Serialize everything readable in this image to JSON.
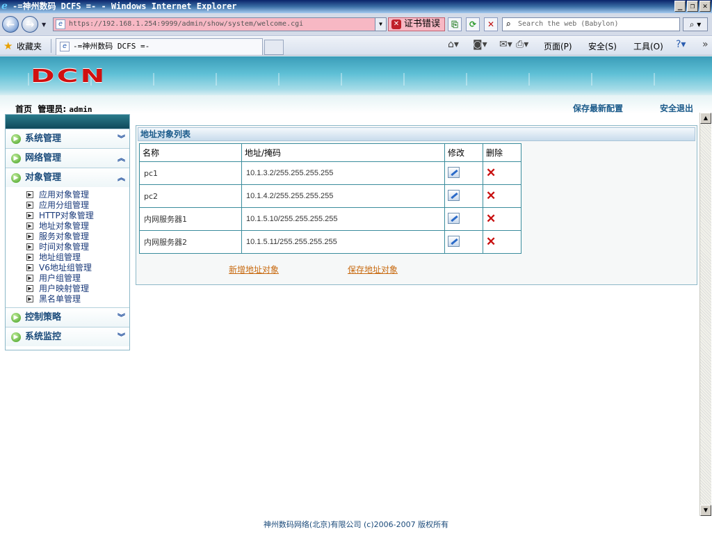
{
  "window": {
    "title": "-=神州数码 DCFS =- - Windows Internet Explorer",
    "buttons": [
      "_",
      "❐",
      "✕"
    ]
  },
  "addressbar": {
    "url": "https://192.168.1.254:9999/admin/show/system/welcome.cgi",
    "cert_error": "证书错误",
    "search_placeholder": "Search the web (Babylon)"
  },
  "commandbar": {
    "favorites": "收藏夹",
    "tab_title": "-=神州数码 DCFS =-",
    "page_menu": "页面(P)",
    "safety_menu": "安全(S)",
    "tools_menu": "工具(O)"
  },
  "header": {
    "logo": "DCN",
    "home": "首页",
    "admin_label": "管理员:",
    "admin_name": "admin",
    "save_config": "保存最新配置",
    "logout": "安全退出"
  },
  "sidebar": {
    "groups": [
      {
        "label": "系统管理",
        "expanded": false
      },
      {
        "label": "网络管理",
        "expanded": true
      },
      {
        "label": "对象管理",
        "expanded": true
      },
      {
        "label": "控制策略",
        "expanded": false
      },
      {
        "label": "系统监控",
        "expanded": false
      }
    ],
    "object_items": [
      "应用对象管理",
      "应用分组管理",
      "HTTP对象管理",
      "地址对象管理",
      "服务对象管理",
      "时间对象管理",
      "地址组管理",
      "V6地址组管理",
      "用户组管理",
      "用户映射管理",
      "黑名单管理"
    ]
  },
  "main": {
    "panel_title": "地址对象列表",
    "columns": [
      "名称",
      "地址/掩码",
      "修改",
      "删除"
    ],
    "rows": [
      {
        "name": "pc1",
        "address": "10.1.3.2/255.255.255.255"
      },
      {
        "name": "pc2",
        "address": "10.1.4.2/255.255.255.255"
      },
      {
        "name": "内网服务器1",
        "address": "10.1.5.10/255.255.255.255"
      },
      {
        "name": "内网服务器2",
        "address": "10.1.5.11/255.255.255.255"
      }
    ],
    "add_link": "新增地址对象",
    "save_link": "保存地址对象"
  },
  "footer": {
    "text": "神州数码网络(北京)有限公司 (c)2006-2007 版权所有"
  },
  "colors": {
    "accent": "#1a5a8a",
    "link": "#c86a10",
    "logo": "#d01010",
    "url_bg": "#f7b8c4"
  }
}
